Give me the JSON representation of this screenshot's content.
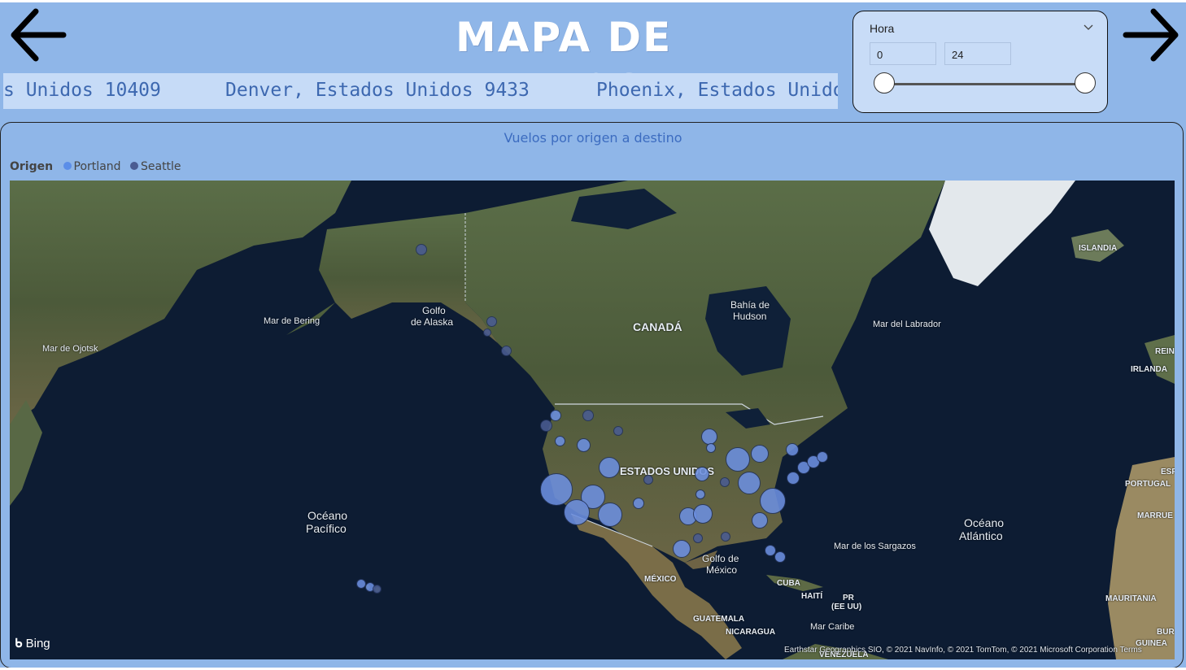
{
  "page": {
    "title": "MAPA DE VUELOS",
    "ticker": [
      "s Unidos 10409",
      "Denver, Estados Unidos 9433",
      "Phoenix, Estados Unido"
    ]
  },
  "nav": {
    "back_icon": "arrow-left-icon",
    "forward_icon": "arrow-right-icon"
  },
  "slicer": {
    "label": "Hora",
    "min_value": "0",
    "max_value": "24",
    "range": [
      0,
      24
    ]
  },
  "visual": {
    "title": "Vuelos por origen a destino",
    "legend_title": "Origen",
    "legend": [
      {
        "name": "Portland",
        "color": "#5b8ee8"
      },
      {
        "name": "Seattle",
        "color": "#4a5c92"
      }
    ]
  },
  "map": {
    "labels": {
      "canada": "CANADÁ",
      "usa": "ESTADOS UNIDOS",
      "mexico": "MÉXICO",
      "cuba": "CUBA",
      "haiti": "HAITÍ",
      "pr": "PR",
      "pr2": "(EE UU)",
      "guatemala": "GUATEMALA",
      "nicaragua": "NICARAGUA",
      "islandia": "ISLANDIA",
      "irlanda": "IRLANDA",
      "rein": "REIN",
      "portugal": "PORTUGAL",
      "esp": "ESP",
      "marrue": "MARRUE",
      "mauritania": "MAURITANIA",
      "guinea": "GUINEA",
      "bur": "BUR",
      "venezuela": "VENEZUELA",
      "pacific1": "Océano",
      "pacific2": "Pacífico",
      "atlantic1": "Océano",
      "atlantic2": "Atlántico",
      "bering": "Mar de Bering",
      "ojotsk": "Mar de Ojotsk",
      "alaska1": "Golfo",
      "alaska2": "de Alaska",
      "hudson1": "Bahía de",
      "hudson2": "Hudson",
      "labrador": "Mar del Labrador",
      "gulf1": "Golfo de",
      "gulf2": "México",
      "sargazos": "Mar de los Sargazos",
      "caribe": "Mar Caribe"
    },
    "provider": "Bing",
    "attribution": "Earthstar Geographics SIO, © 2021 NavInfo, © 2021 TomTom, © 2021 Microsoft Corporation  Terms"
  }
}
